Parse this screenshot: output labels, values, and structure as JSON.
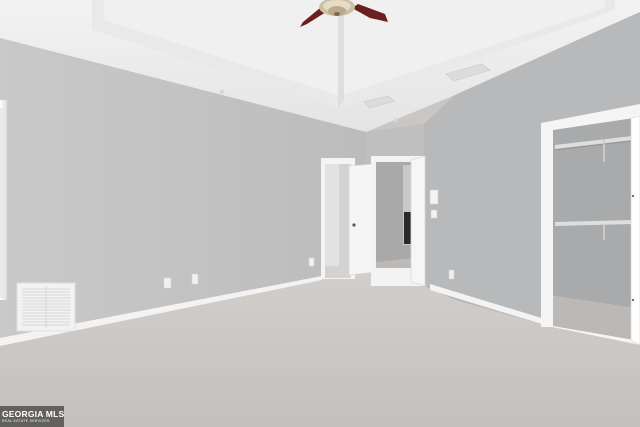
{
  "watermark": {
    "brand": "GEORGIA MLS",
    "tagline": "REAL ESTATE SERVICES"
  },
  "colors": {
    "wall": "#c1c1c1",
    "wall_right": "#b7b8b9",
    "ceiling": "#ececec",
    "carpet": "#cbc7c4",
    "trim": "#f4f4f4",
    "fan_blade": "#6b2020"
  }
}
